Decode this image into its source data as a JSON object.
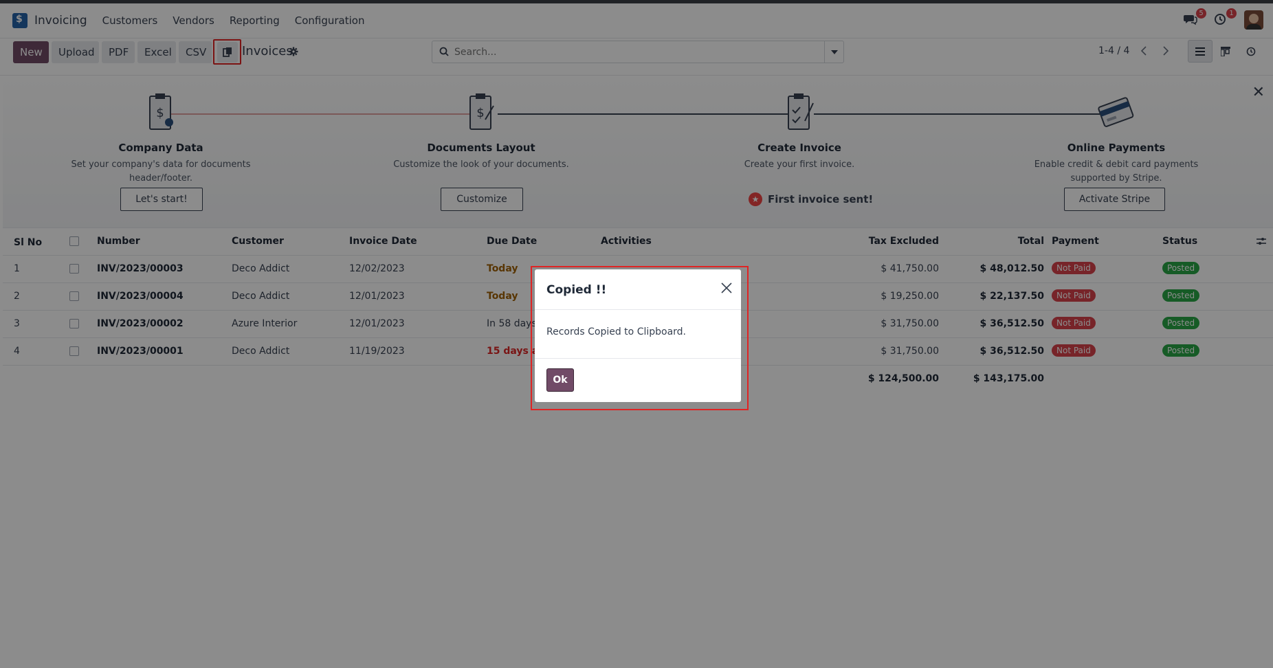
{
  "navbar": {
    "app_name": "Invoicing",
    "menu": [
      "Customers",
      "Vendors",
      "Reporting",
      "Configuration"
    ],
    "messages_count": "5",
    "activities_count": "1"
  },
  "control": {
    "new_label": "New",
    "upload_label": "Upload",
    "pdf_label": "PDF",
    "excel_label": "Excel",
    "csv_label": "CSV",
    "page_title": "Invoices",
    "search_placeholder": "Search...",
    "pager": "1-4 / 4"
  },
  "onboarding": {
    "steps": [
      {
        "title": "Company Data",
        "desc1": "Set your company's data for documents",
        "desc2": "header/footer.",
        "button": "Let's start!"
      },
      {
        "title": "Documents Layout",
        "desc1": "Customize the look of your documents.",
        "desc2": "",
        "button": "Customize"
      },
      {
        "title": "Create Invoice",
        "desc1": "Create your first invoice.",
        "desc2": "",
        "done": "First invoice sent!"
      },
      {
        "title": "Online Payments",
        "desc1": "Enable credit & debit card payments",
        "desc2": "supported by Stripe.",
        "button": "Activate Stripe"
      }
    ]
  },
  "table": {
    "headers": {
      "slno": "Sl No",
      "number": "Number",
      "customer": "Customer",
      "invoice_date": "Invoice Date",
      "due_date": "Due Date",
      "activities": "Activities",
      "tax_excluded": "Tax Excluded",
      "total": "Total",
      "payment": "Payment",
      "status": "Status"
    },
    "rows": [
      {
        "slno": "1",
        "number": "INV/2023/00003",
        "customer": "Deco Addict",
        "invoice_date": "12/02/2023",
        "due_date": "Today",
        "tax_excluded": "$ 41,750.00",
        "total": "$ 48,012.50",
        "payment": "Not Paid",
        "status": "Posted"
      },
      {
        "slno": "2",
        "number": "INV/2023/00004",
        "customer": "Deco Addict",
        "invoice_date": "12/01/2023",
        "due_date": "Today",
        "tax_excluded": "$ 19,250.00",
        "total": "$ 22,137.50",
        "payment": "Not Paid",
        "status": "Posted"
      },
      {
        "slno": "3",
        "number": "INV/2023/00002",
        "customer": "Azure Interior",
        "invoice_date": "12/01/2023",
        "due_date": "In 58 days",
        "tax_excluded": "$ 31,750.00",
        "total": "$ 36,512.50",
        "payment": "Not Paid",
        "status": "Posted"
      },
      {
        "slno": "4",
        "number": "INV/2023/00001",
        "customer": "Deco Addict",
        "invoice_date": "11/19/2023",
        "due_date": "15 days ago",
        "tax_excluded": "$ 31,750.00",
        "total": "$ 36,512.50",
        "payment": "Not Paid",
        "status": "Posted"
      }
    ],
    "totals": {
      "tax_excluded": "$ 124,500.00",
      "total": "$ 143,175.00"
    }
  },
  "modal": {
    "title": "Copied !!",
    "message": "Records Copied to Clipboard.",
    "ok_label": "Ok"
  },
  "colors": {
    "brand": "#714b67",
    "danger": "#d9434b",
    "success": "#28a745",
    "highlight": "#e02424"
  }
}
